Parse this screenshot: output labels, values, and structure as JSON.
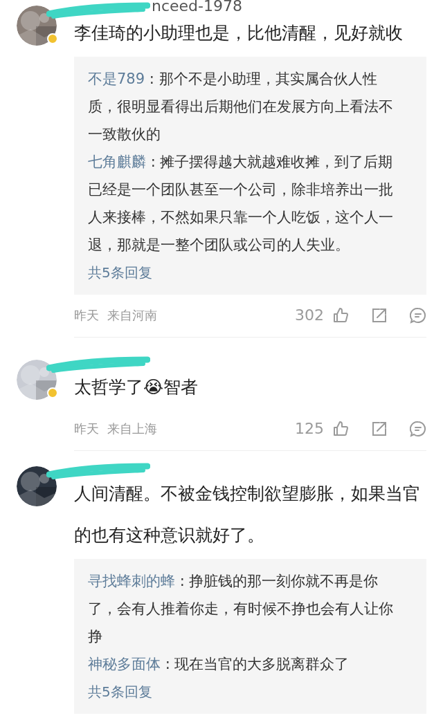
{
  "comments": [
    {
      "username": "nceed-1978",
      "verified": true,
      "text": "李佳琦的小助理也是，比他清醒，见好就收",
      "replies": [
        {
          "author": "不是789",
          "separator": ":",
          "text": "那个不是小助理，其实属合伙人性质，很明显看得出后期他们在发展方向上看法不一致散伙的"
        },
        {
          "author": "七角麒麟",
          "separator": ":",
          "text": "摊子摆得越大就越难收摊，到了后期已经是一个团队甚至一个公司，除非培养出一批人来接棒，不然如果只靠一个人吃饭，这个人一退，那就是一整个团队或公司的人失业。"
        }
      ],
      "more_replies": "共5条回复",
      "time": "昨天",
      "location": "来自河南",
      "likes": "302"
    },
    {
      "verified": true,
      "text": "太哲学了😭智者",
      "time": "昨天",
      "location": "来自上海",
      "likes": "125"
    },
    {
      "verified": false,
      "text": "人间清醒。不被金钱控制欲望膨胀，如果当官的也有这种意识就好了。",
      "replies": [
        {
          "author": "寻找蜂刺的蜂",
          "separator": ":",
          "text": "挣脏钱的那一刻你就不再是你了，会有人推着你走，有时候不挣也会有人让你挣"
        },
        {
          "author": "神秘多面体",
          "separator": ":",
          "text": "现在当官的大多脱离群众了"
        }
      ],
      "more_replies": "共5条回复"
    }
  ]
}
